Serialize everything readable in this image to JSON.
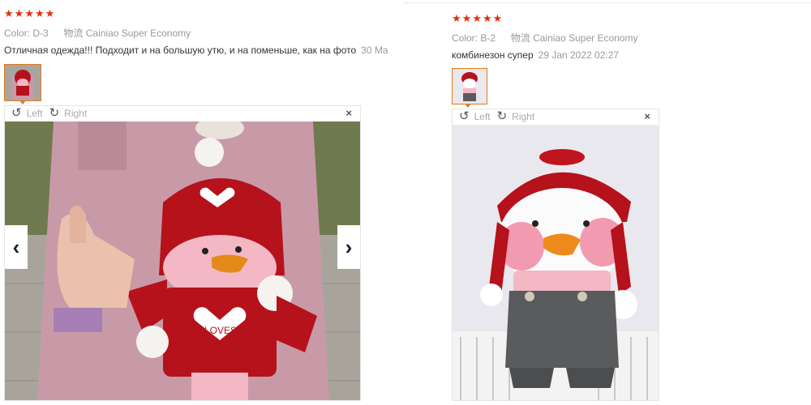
{
  "reviews": [
    {
      "color_label": "Color:",
      "color_value": "D-3",
      "shipping": "物流 Cainiao Super Economy",
      "text": "Отличная одежда!!! Подходит и на большую утю, и на поменьше, как на фото",
      "date": "30 Ma",
      "viewer": {
        "left": "Left",
        "right": "Right",
        "close": "×"
      },
      "colors": {
        "coat": "#c89aa8",
        "hat": "#b5121b",
        "face": "#f4b7c4"
      }
    },
    {
      "color_label": "Color:",
      "color_value": "B-2",
      "shipping": "物流 Cainiao Super Economy",
      "text": "комбинезон супер",
      "date": "29 Jan 2022 02:27",
      "viewer": {
        "left": "Left",
        "right": "Right",
        "close": "×"
      },
      "colors": {
        "wall": "#e9e8ee",
        "hat": "#b5121b",
        "pants": "#5a5b5c"
      }
    }
  ],
  "stars": [
    "★",
    "★",
    "★",
    "★",
    "★"
  ],
  "icons": {
    "rotate_left": "rotate-left-icon",
    "rotate_right": "rotate-right-icon",
    "prev": "chevron-left-icon",
    "next": "chevron-right-icon"
  },
  "accent": "#e62e04"
}
